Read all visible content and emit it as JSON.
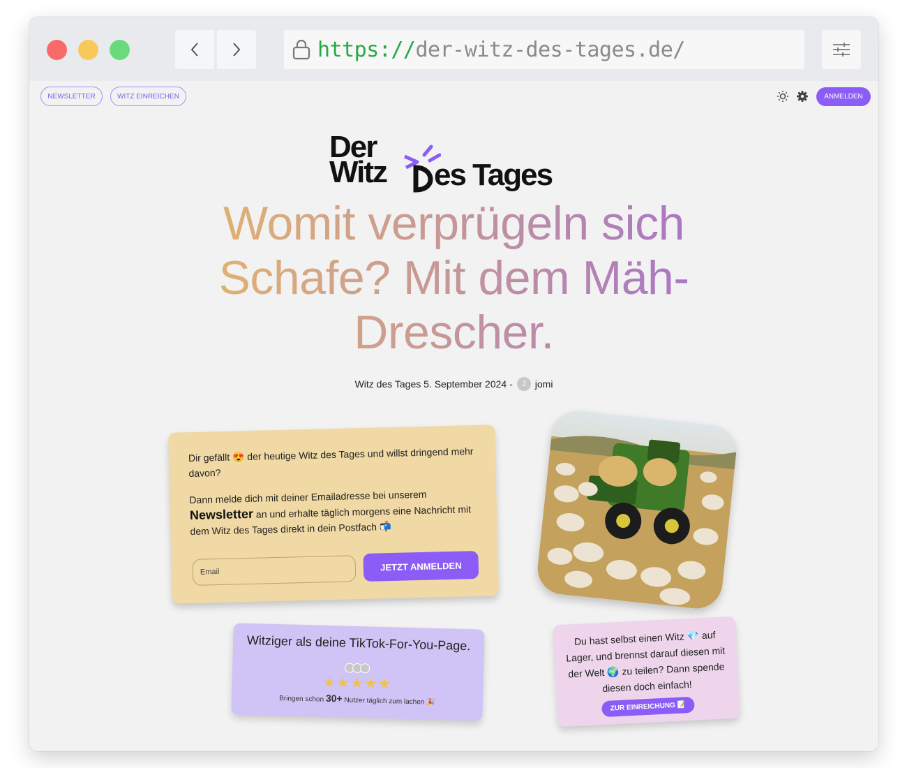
{
  "browser": {
    "url_protocol": "https://",
    "url_host": "der-witz-des-tages.de/"
  },
  "topbar": {
    "newsletter_label": "NEWSLETTER",
    "submit_joke_label": "WITZ EINREICHEN",
    "login_label": "ANMELDEN"
  },
  "logo": {
    "line1": "Der",
    "line2": "Witz",
    "line2b": "es Tages",
    "alt_text": "Der Witz Des Tages"
  },
  "headline": "Womit verprügeln sich Schafe? Mit dem Mäh-Drescher.",
  "meta": {
    "prefix": "Witz des Tages 5. September 2024 -",
    "author_initial": "J",
    "author": "jomi"
  },
  "newsletter_card": {
    "p1_before": "Dir gefällt",
    "p1_emoji": "😍",
    "p1_after": "der heutige Witz des Tages und willst dringend mehr davon?",
    "p2_before": "Dann melde dich mit deiner Emailadresse bei unserem",
    "p2_strong": "Newsletter",
    "p2_after": "an und erhalte täglich morgens eine Nachricht mit dem Witz des Tages direkt in dein Postfach",
    "p2_emoji": "📬",
    "email_placeholder": "Email",
    "subscribe_label": "JETZT ANMELDEN"
  },
  "tiktok_card": {
    "title": "Witziger als deine TikTok-For-You-Page.",
    "stars": "★★★★★",
    "users_before": "Bringen schon",
    "users_count": "30+",
    "users_after": "Nutzer täglich zum lachen",
    "users_emoji": "🎉"
  },
  "submit_card": {
    "text_a": "Du hast selbst einen Witz",
    "emoji_a": "💎",
    "text_b": "auf Lager, und brennst darauf diesen mit der Welt",
    "emoji_b": "🌍",
    "text_c": "zu teilen? Dann spende diesen doch einfach!",
    "button_label": "ZUR EINREICHUNG",
    "button_emoji": "📝"
  },
  "colors": {
    "accent": "#8b5cf6",
    "headline_gradient_start": "#e6b66a",
    "headline_gradient_end": "#a46fcf",
    "newsletter_card_bg": "#f0d9a4",
    "tiktok_card_bg": "#cfc4f5",
    "submit_card_bg": "#eed5ec"
  }
}
